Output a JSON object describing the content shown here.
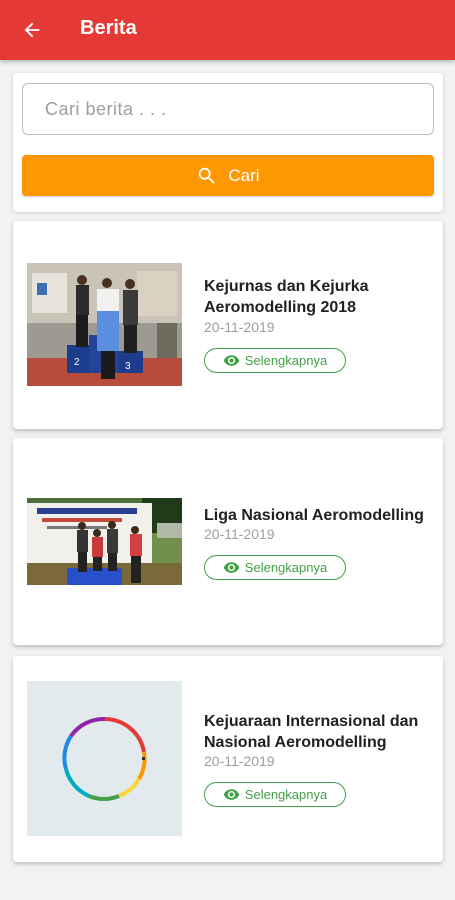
{
  "appbar": {
    "title": "Berita",
    "back_icon": "arrow-left-icon"
  },
  "search": {
    "placeholder": "Cari berita . . .",
    "value": "",
    "button_label": "Cari",
    "button_icon": "search-icon"
  },
  "colors": {
    "primary": "#e53935",
    "accent": "#ff9800",
    "green": "#43a047"
  },
  "news": [
    {
      "title": "Kejurnas dan Kejurka Aeromodelling 2018",
      "date": "20-11-2019",
      "button_label": "Selengkapnya",
      "thumbnail": "podium-photo"
    },
    {
      "title": "Liga Nasional Aeromodelling",
      "date": "20-11-2019",
      "button_label": "Selengkapnya",
      "thumbnail": "group-photo"
    },
    {
      "title": "Kejuaraan Internasional dan Nasional Aeromodelling",
      "date": "20-11-2019",
      "button_label": "Selengkapnya",
      "thumbnail": "loading-placeholder"
    }
  ]
}
